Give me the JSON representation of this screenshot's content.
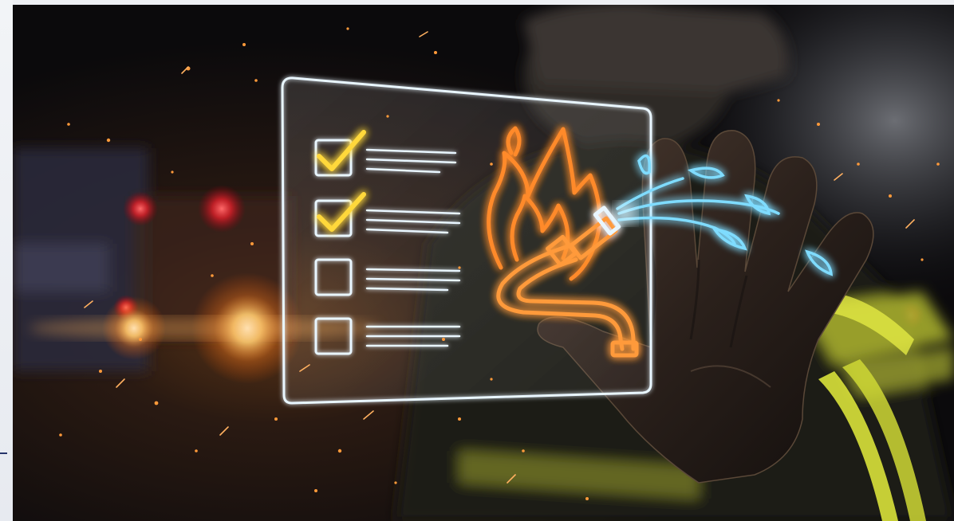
{
  "image": {
    "subject": "firefighter-hand-holographic-checklist",
    "icons": [
      "check-icon",
      "checkbox-empty-icon",
      "flame-icon",
      "fire-hose-icon",
      "water-drop-icon",
      "glove-icon",
      "helmet-icon"
    ],
    "checklist": [
      {
        "checked": true
      },
      {
        "checked": true
      },
      {
        "checked": false
      },
      {
        "checked": false
      }
    ],
    "colors": {
      "hologram_frame": "#e9f6ff",
      "check_yellow": "#ffd83a",
      "flame_orange": "#ff8a2a",
      "water_blue": "#7fdcff",
      "reflective_stripe": "#d9e23a",
      "background_dark": "#0c0b0d"
    }
  }
}
